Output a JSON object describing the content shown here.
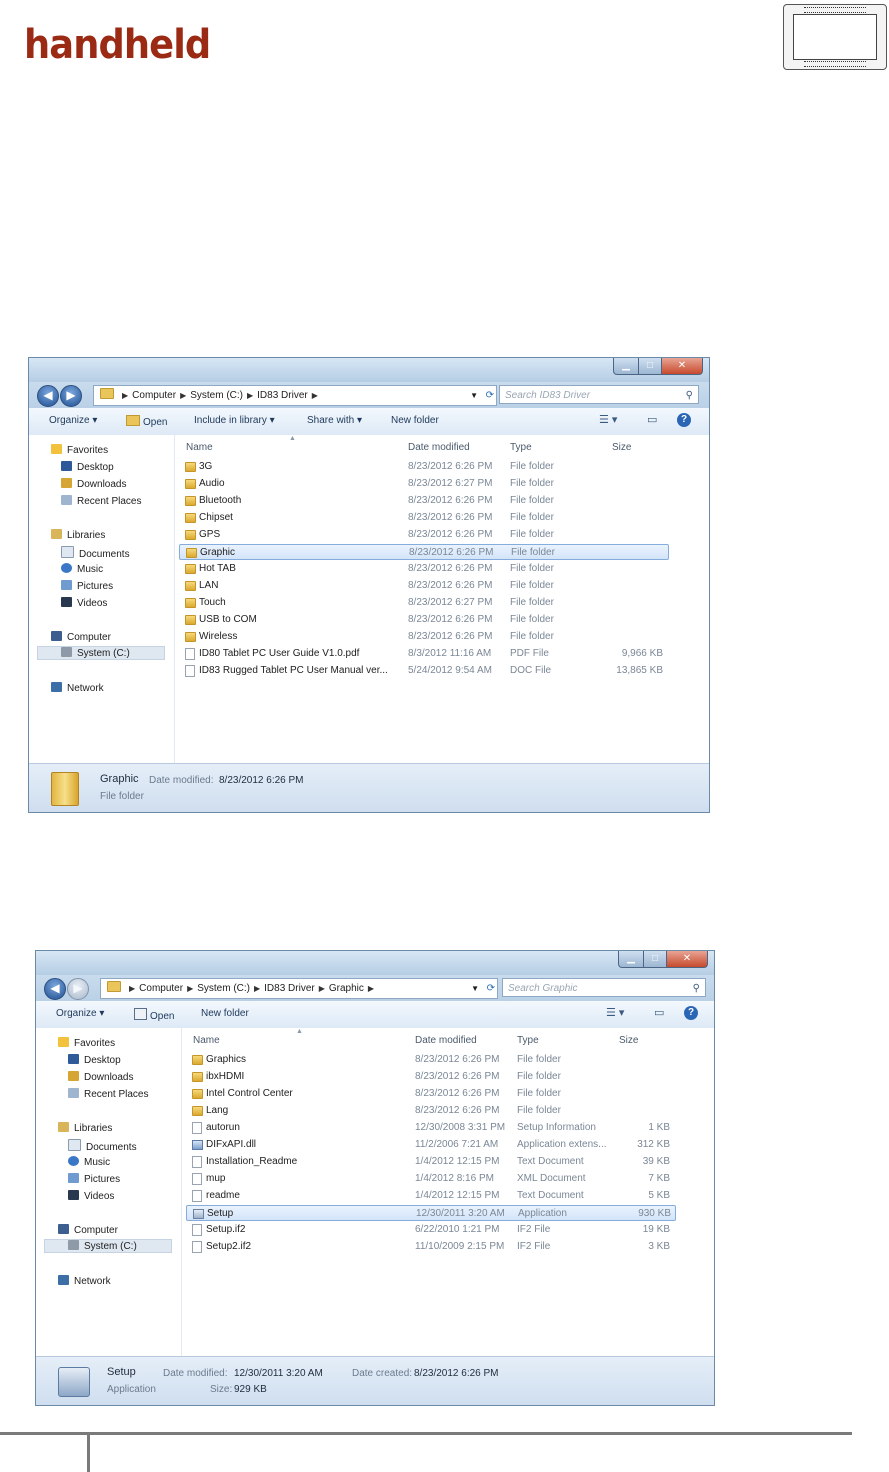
{
  "brand": "handheld",
  "colors": {
    "brand": "#9b2a14",
    "selection": "#d3e5fa",
    "folder": "#e9c55a",
    "titlebar": "#b5cde4"
  },
  "windows": [
    {
      "breadcrumb": [
        "Computer",
        "System (C:)",
        "ID83 Driver"
      ],
      "search_placeholder": "Search ID83 Driver",
      "toolbar": {
        "organize": "Organize ▾",
        "open": "Open",
        "include": "Include in library ▾",
        "share": "Share with ▾",
        "new_folder": "New folder"
      },
      "columns": {
        "name": "Name",
        "date": "Date modified",
        "type": "Type",
        "size": "Size"
      },
      "nav": {
        "favorites": "Favorites",
        "desktop": "Desktop",
        "downloads": "Downloads",
        "recent": "Recent Places",
        "libraries": "Libraries",
        "documents": "Documents",
        "music": "Music",
        "pictures": "Pictures",
        "videos": "Videos",
        "computer": "Computer",
        "system": "System (C:)",
        "network": "Network"
      },
      "rows": [
        {
          "icon": "folder-icon",
          "name": "3G",
          "date": "8/23/2012 6:26 PM",
          "type": "File folder",
          "size": ""
        },
        {
          "icon": "folder-icon",
          "name": "Audio",
          "date": "8/23/2012 6:27 PM",
          "type": "File folder",
          "size": ""
        },
        {
          "icon": "folder-icon",
          "name": "Bluetooth",
          "date": "8/23/2012 6:26 PM",
          "type": "File folder",
          "size": ""
        },
        {
          "icon": "folder-icon",
          "name": "Chipset",
          "date": "8/23/2012 6:26 PM",
          "type": "File folder",
          "size": ""
        },
        {
          "icon": "folder-icon",
          "name": "GPS",
          "date": "8/23/2012 6:26 PM",
          "type": "File folder",
          "size": ""
        },
        {
          "icon": "folder-icon",
          "name": "Graphic",
          "date": "8/23/2012 6:26 PM",
          "type": "File folder",
          "size": "",
          "selected": true
        },
        {
          "icon": "folder-icon",
          "name": "Hot TAB",
          "date": "8/23/2012 6:26 PM",
          "type": "File folder",
          "size": ""
        },
        {
          "icon": "folder-icon",
          "name": "LAN",
          "date": "8/23/2012 6:26 PM",
          "type": "File folder",
          "size": ""
        },
        {
          "icon": "folder-icon",
          "name": "Touch",
          "date": "8/23/2012 6:27 PM",
          "type": "File folder",
          "size": ""
        },
        {
          "icon": "folder-icon",
          "name": "USB to COM",
          "date": "8/23/2012 6:26 PM",
          "type": "File folder",
          "size": ""
        },
        {
          "icon": "folder-icon",
          "name": "Wireless",
          "date": "8/23/2012 6:26 PM",
          "type": "File folder",
          "size": ""
        },
        {
          "icon": "pdf-file-icon",
          "name": "ID80 Tablet PC User Guide V1.0.pdf",
          "date": "8/3/2012 11:16 AM",
          "type": "PDF File",
          "size": "9,966 KB"
        },
        {
          "icon": "doc-file-icon",
          "name": "ID83 Rugged Tablet PC  User Manual ver...",
          "date": "5/24/2012 9:54 AM",
          "type": "DOC File",
          "size": "13,865 KB"
        }
      ],
      "details": {
        "name": "Graphic",
        "date_label": "Date modified:",
        "date_value": "8/23/2012 6:26 PM",
        "type": "File folder"
      }
    },
    {
      "breadcrumb": [
        "Computer",
        "System (C:)",
        "ID83 Driver",
        "Graphic"
      ],
      "search_placeholder": "Search Graphic",
      "toolbar": {
        "organize": "Organize ▾",
        "open": "Open",
        "new_folder": "New folder"
      },
      "columns": {
        "name": "Name",
        "date": "Date modified",
        "type": "Type",
        "size": "Size"
      },
      "nav": {
        "favorites": "Favorites",
        "desktop": "Desktop",
        "downloads": "Downloads",
        "recent": "Recent Places",
        "libraries": "Libraries",
        "documents": "Documents",
        "music": "Music",
        "pictures": "Pictures",
        "videos": "Videos",
        "computer": "Computer",
        "system": "System (C:)",
        "network": "Network"
      },
      "rows": [
        {
          "icon": "folder-icon",
          "name": "Graphics",
          "date": "8/23/2012 6:26 PM",
          "type": "File folder",
          "size": ""
        },
        {
          "icon": "folder-icon",
          "name": "ibxHDMI",
          "date": "8/23/2012 6:26 PM",
          "type": "File folder",
          "size": ""
        },
        {
          "icon": "folder-icon",
          "name": "Intel Control Center",
          "date": "8/23/2012 6:26 PM",
          "type": "File folder",
          "size": ""
        },
        {
          "icon": "folder-icon",
          "name": "Lang",
          "date": "8/23/2012 6:26 PM",
          "type": "File folder",
          "size": ""
        },
        {
          "icon": "setup-info-icon",
          "name": "autorun",
          "date": "12/30/2008 3:31 PM",
          "type": "Setup Information",
          "size": "1 KB"
        },
        {
          "icon": "dll-file-icon",
          "name": "DIFxAPI.dll",
          "date": "11/2/2006 7:21 AM",
          "type": "Application extens...",
          "size": "312 KB"
        },
        {
          "icon": "text-file-icon",
          "name": "Installation_Readme",
          "date": "1/4/2012 12:15 PM",
          "type": "Text Document",
          "size": "39 KB"
        },
        {
          "icon": "xml-file-icon",
          "name": "mup",
          "date": "1/4/2012 8:16 PM",
          "type": "XML Document",
          "size": "7 KB"
        },
        {
          "icon": "text-file-icon",
          "name": "readme",
          "date": "1/4/2012 12:15 PM",
          "type": "Text Document",
          "size": "5 KB"
        },
        {
          "icon": "setup-app-icon",
          "name": "Setup",
          "date": "12/30/2011 3:20 AM",
          "type": "Application",
          "size": "930 KB",
          "selected": true
        },
        {
          "icon": "file-icon",
          "name": "Setup.if2",
          "date": "6/22/2010 1:21 PM",
          "type": "IF2 File",
          "size": "19 KB"
        },
        {
          "icon": "file-icon",
          "name": "Setup2.if2",
          "date": "11/10/2009 2:15 PM",
          "type": "IF2 File",
          "size": "3 KB"
        }
      ],
      "details": {
        "name": "Setup",
        "date_label": "Date modified:",
        "date_value": "12/30/2011 3:20 AM",
        "created_label": "Date created:",
        "created_value": "8/23/2012 6:26 PM",
        "type": "Application",
        "size_label": "Size:",
        "size_value": "929 KB"
      }
    }
  ]
}
